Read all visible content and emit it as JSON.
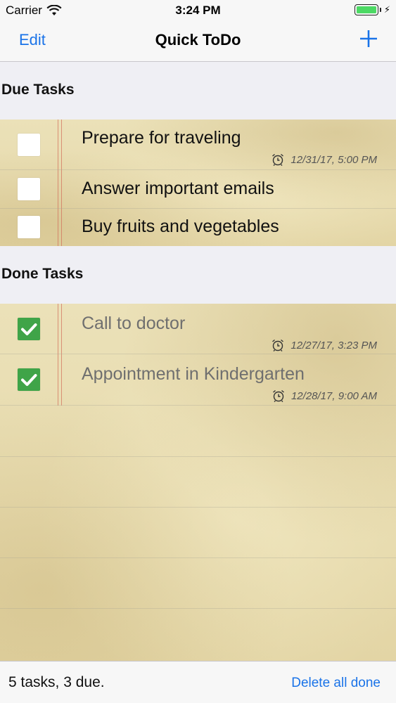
{
  "status_bar": {
    "carrier": "Carrier",
    "time": "3:24 PM",
    "battery_level": 1.0
  },
  "nav": {
    "edit_label": "Edit",
    "title": "Quick ToDo",
    "add_icon": "plus-icon"
  },
  "sections": [
    {
      "title": "Due Tasks",
      "tasks": [
        {
          "title": "Prepare for traveling",
          "done": false,
          "due": "12/31/17, 5:00 PM"
        },
        {
          "title": "Answer important emails",
          "done": false,
          "due": ""
        },
        {
          "title": "Buy fruits and vegetables",
          "done": false,
          "due": ""
        }
      ]
    },
    {
      "title": "Done Tasks",
      "tasks": [
        {
          "title": "Call to doctor",
          "done": true,
          "due": "12/27/17, 3:23 PM"
        },
        {
          "title": "Appointment in Kindergarten",
          "done": true,
          "due": "12/28/17, 9:00 AM"
        }
      ]
    }
  ],
  "toolbar": {
    "summary": "5 tasks, 3 due.",
    "delete_label": "Delete all done"
  },
  "colors": {
    "accent": "#1a73e8",
    "check_green": "#3fa448",
    "margin_line": "#d26e5a"
  }
}
